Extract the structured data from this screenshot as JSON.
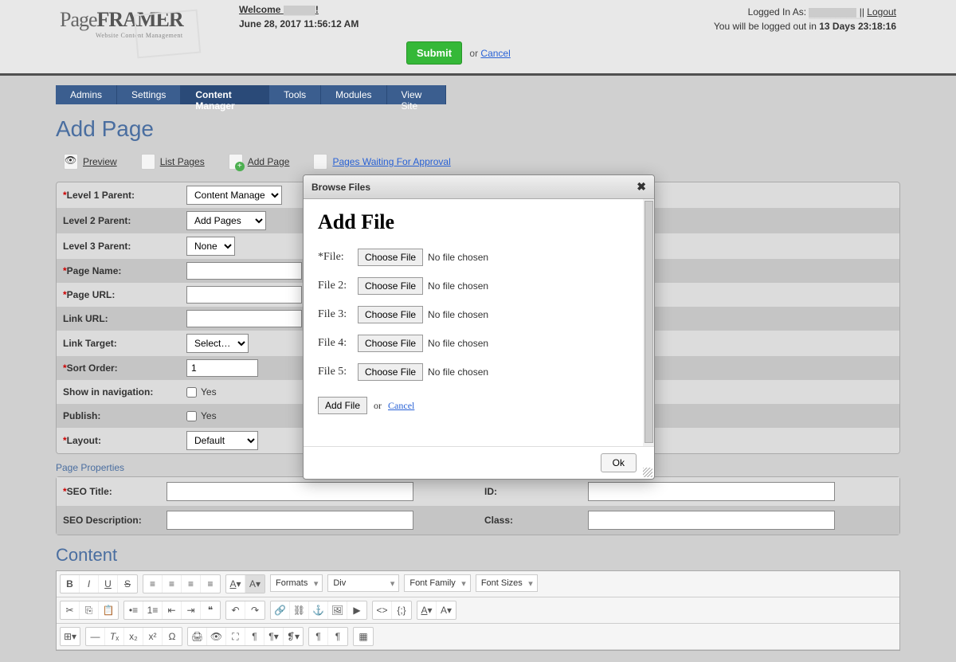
{
  "header": {
    "logo_text_a": "Page",
    "logo_text_b": "FRAMER",
    "logo_sub": "Website Content Management",
    "welcome_prefix": "Welcome",
    "welcome_user": "______",
    "datetime": "June 28, 2017 11:56:12 AM",
    "logged_in_prefix": "Logged In As:",
    "logged_in_user": "__________",
    "logout": "Logout",
    "timer_prefix": "You will be logged out in",
    "timer_value": "13 Days 23:18:16",
    "submit": "Submit",
    "or": "or",
    "cancel": "Cancel"
  },
  "nav": [
    "Admins",
    "Settings",
    "Content Manager",
    "Tools",
    "Modules",
    "View Site"
  ],
  "nav_active": 2,
  "page_title": "Add Page",
  "actions": {
    "preview": "Preview",
    "list_pages": "List Pages",
    "add_page": "Add Page",
    "pages_waiting": "Pages Waiting For Approval"
  },
  "form": {
    "level1_label": "Level 1 Parent:",
    "level1_value": "Content Manager",
    "level2_label": "Level 2 Parent:",
    "level2_value": "Add Pages",
    "level3_label": "Level 3 Parent:",
    "level3_value": "None",
    "page_name_label": "Page Name:",
    "page_name_value": "",
    "page_url_label": "Page URL:",
    "page_url_value": "",
    "link_url_label": "Link URL:",
    "link_url_value": "",
    "link_target_label": "Link Target:",
    "link_target_value": "Select…",
    "sort_order_label": "Sort Order:",
    "sort_order_value": "1",
    "show_nav_label": "Show in navigation:",
    "show_nav_text": "Yes",
    "publish_label": "Publish:",
    "publish_text": "Yes",
    "layout_label": "Layout:",
    "layout_value": "Default"
  },
  "props": {
    "section": "Page Properties",
    "seo_title_label": "SEO Title:",
    "seo_title_value": "",
    "seo_desc_label": "SEO Description:",
    "seo_desc_value": "",
    "id_label": "ID:",
    "id_value": "",
    "class_label": "Class:",
    "class_value": ""
  },
  "content": {
    "title": "Content",
    "formats": "Formats",
    "div": "Div",
    "font_family": "Font Family",
    "font_sizes": "Font Sizes"
  },
  "modal": {
    "title": "Browse Files",
    "heading": "Add File",
    "rows": [
      {
        "label": "*File:",
        "btn": "Choose File",
        "status": "No file chosen"
      },
      {
        "label": "File 2:",
        "btn": "Choose File",
        "status": "No file chosen"
      },
      {
        "label": "File 3:",
        "btn": "Choose File",
        "status": "No file chosen"
      },
      {
        "label": "File 4:",
        "btn": "Choose File",
        "status": "No file chosen"
      },
      {
        "label": "File 5:",
        "btn": "Choose File",
        "status": "No file chosen"
      }
    ],
    "add_file_btn": "Add File",
    "or": "or",
    "cancel": "Cancel",
    "ok": "Ok"
  }
}
